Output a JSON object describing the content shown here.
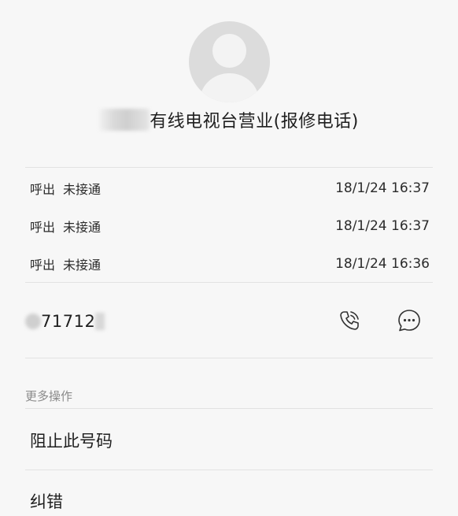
{
  "contact": {
    "name": "有线电视台营业(报修电话)"
  },
  "call_log": [
    {
      "direction": "呼出",
      "status": "未接通",
      "time": "18/1/24 16:37"
    },
    {
      "direction": "呼出",
      "status": "未接通",
      "time": "18/1/24 16:37"
    },
    {
      "direction": "呼出",
      "status": "未接通",
      "time": "18/1/24 16:36"
    }
  ],
  "number": {
    "visible_text": "71712"
  },
  "icons": {
    "call": "phone-call-icon",
    "message": "message-bubble-icon"
  },
  "more_actions": {
    "label": "更多操作",
    "items": [
      "阻止此号码",
      "纠错"
    ]
  }
}
